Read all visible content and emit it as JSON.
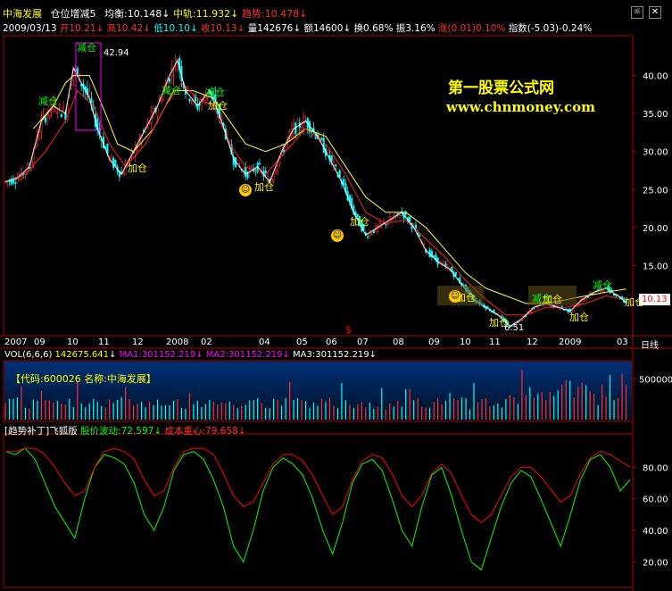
{
  "header": {
    "name": "中海发展",
    "indicator": "仓位增减5",
    "avg_label": "均衡:",
    "avg_value": "10.148",
    "mid_label": "中轨:",
    "mid_value": "11.932",
    "trend_label": "趋势:",
    "trend_value": "10.478",
    "date": "2009/03/13",
    "open": "开10.21",
    "high": "高10.42",
    "low": "低10.10",
    "close": "收10.13",
    "volume": "量142676",
    "amount": "额14600",
    "turnover": "换0.68%",
    "amplitude": "振3.16%",
    "change": "涨(0.01)0.10%",
    "index": "指数(-5.03)-0.24%",
    "colors": {
      "name": "#ffff00",
      "up": "#ff3030",
      "down": "#00ffff",
      "white": "#ffffff"
    }
  },
  "watermark": {
    "title": "第一股票公式网",
    "url": "www.chnmoney.com",
    "color": "#ffff00"
  },
  "annotations": [
    {
      "text": "减仓",
      "color": "#00ff00"
    },
    {
      "text": "减仓",
      "color": "#00ff00"
    },
    {
      "text": "减仓",
      "color": "#00ff00"
    },
    {
      "text": "减仓",
      "color": "#00ff00"
    },
    {
      "text": "减仓",
      "color": "#00ff00"
    },
    {
      "text": "减仓",
      "color": "#00ff00"
    },
    {
      "text": "加仓",
      "color": "#ffff00"
    },
    {
      "text": "加仓",
      "color": "#ffff00"
    },
    {
      "text": "加仓",
      "color": "#ffff00"
    },
    {
      "text": "加仓",
      "color": "#ffff00"
    },
    {
      "text": "加仓",
      "color": "#ffff00"
    },
    {
      "text": "加仓",
      "color": "#ffff00"
    },
    {
      "text": "加仓",
      "color": "#ffff00"
    },
    {
      "text": "加仓",
      "color": "#ffff00"
    },
    {
      "text": "加仓",
      "color": "#ffff00"
    }
  ],
  "extremes": {
    "high": "42.94",
    "low": "6.51"
  },
  "last_price_tag": "10.13",
  "dollar_mark": "$",
  "smileys": 3,
  "time_axis": {
    "labels": [
      "2007",
      "09",
      "10",
      "11",
      "12",
      "2008",
      "02",
      "04",
      "05",
      "06",
      "07",
      "08",
      "09",
      "10",
      "11",
      "12",
      "2009",
      "03"
    ],
    "period": "日线"
  },
  "vol_header": {
    "title": "VOL(6,6,6)",
    "vol": "142675.641",
    "ma1": "MA1:301152.219",
    "ma2": "MA2:301152.219",
    "ma3": "MA3:301152.219",
    "info": "【代码:600026 名称:中海发展】"
  },
  "ind_header": {
    "title": "[趋势补丁]飞狐版",
    "wave_label": "股价波动:",
    "wave_value": "72.597",
    "cost_label": "成本重心:",
    "cost_value": "79.658"
  },
  "chart_data": [
    {
      "type": "candlestick",
      "title": "中海发展",
      "y_axis_ticks": [
        15.0,
        20.0,
        25.0,
        30.0,
        35.0,
        40.0
      ],
      "ylim": [
        6,
        45
      ],
      "grid": false,
      "close_path": [
        [
          0,
          26
        ],
        [
          6,
          26.5
        ],
        [
          12,
          28
        ],
        [
          18,
          34
        ],
        [
          24,
          36
        ],
        [
          30,
          35
        ],
        [
          34,
          41
        ],
        [
          38,
          39
        ],
        [
          42,
          37
        ],
        [
          46,
          33
        ],
        [
          52,
          29
        ],
        [
          58,
          27
        ],
        [
          64,
          30
        ],
        [
          70,
          33
        ],
        [
          76,
          36
        ],
        [
          82,
          40
        ],
        [
          86,
          42
        ],
        [
          90,
          38
        ],
        [
          96,
          36
        ],
        [
          102,
          38
        ],
        [
          108,
          34
        ],
        [
          114,
          29
        ],
        [
          120,
          27
        ],
        [
          126,
          28
        ],
        [
          132,
          26
        ],
        [
          138,
          30
        ],
        [
          144,
          33
        ],
        [
          150,
          34
        ],
        [
          156,
          32
        ],
        [
          162,
          29
        ],
        [
          168,
          26
        ],
        [
          174,
          22
        ],
        [
          180,
          19
        ],
        [
          186,
          20
        ],
        [
          192,
          21
        ],
        [
          198,
          22
        ],
        [
          204,
          20
        ],
        [
          210,
          17
        ],
        [
          216,
          15.5
        ],
        [
          222,
          14.5
        ],
        [
          228,
          12.5
        ],
        [
          234,
          10.5
        ],
        [
          240,
          9.5
        ],
        [
          246,
          8.5
        ],
        [
          252,
          7
        ],
        [
          258,
          8
        ],
        [
          264,
          9.5
        ],
        [
          270,
          10
        ],
        [
          276,
          9.5
        ],
        [
          282,
          9
        ],
        [
          288,
          10.5
        ],
        [
          294,
          11.5
        ],
        [
          300,
          12
        ],
        [
          306,
          11
        ],
        [
          310,
          10.13
        ]
      ],
      "red_line": [
        [
          0,
          26
        ],
        [
          10,
          27
        ],
        [
          20,
          30
        ],
        [
          30,
          34
        ],
        [
          36,
          38
        ],
        [
          44,
          36
        ],
        [
          52,
          31
        ],
        [
          60,
          28
        ],
        [
          70,
          31
        ],
        [
          80,
          36
        ],
        [
          88,
          39
        ],
        [
          96,
          37
        ],
        [
          104,
          36
        ],
        [
          112,
          31
        ],
        [
          120,
          28
        ],
        [
          130,
          27
        ],
        [
          140,
          30
        ],
        [
          150,
          33
        ],
        [
          160,
          31
        ],
        [
          170,
          27
        ],
        [
          180,
          22
        ],
        [
          190,
          20.5
        ],
        [
          200,
          21
        ],
        [
          210,
          18.5
        ],
        [
          220,
          16
        ],
        [
          230,
          13
        ],
        [
          240,
          10.5
        ],
        [
          250,
          8.5
        ],
        [
          260,
          8.5
        ],
        [
          270,
          9.5
        ],
        [
          280,
          9.5
        ],
        [
          290,
          10
        ],
        [
          300,
          11
        ],
        [
          310,
          10.5
        ]
      ],
      "yellow_line": [
        [
          14,
          33
        ],
        [
          24,
          36
        ],
        [
          30,
          39
        ],
        [
          34,
          40
        ],
        [
          42,
          40
        ],
        [
          50,
          35
        ],
        [
          56,
          31
        ],
        [
          64,
          30
        ],
        [
          74,
          33
        ],
        [
          84,
          38
        ],
        [
          94,
          38
        ],
        [
          104,
          37
        ],
        [
          112,
          34
        ],
        [
          120,
          31
        ],
        [
          130,
          30
        ],
        [
          140,
          31
        ],
        [
          150,
          33
        ],
        [
          160,
          32
        ],
        [
          170,
          28
        ],
        [
          180,
          24
        ],
        [
          190,
          22
        ],
        [
          200,
          22
        ],
        [
          210,
          20
        ],
        [
          220,
          17
        ],
        [
          230,
          14
        ],
        [
          240,
          12
        ],
        [
          250,
          11
        ],
        [
          260,
          10
        ],
        [
          270,
          10
        ],
        [
          280,
          10.5
        ],
        [
          290,
          11
        ],
        [
          300,
          11.5
        ],
        [
          310,
          11.9
        ]
      ]
    },
    {
      "type": "bar",
      "title": "VOL(6,6,6)",
      "y_axis_ticks": [
        500000
      ],
      "ylim": [
        0,
        700000
      ],
      "grid": false,
      "series_name": "VOL"
    },
    {
      "type": "line",
      "title": "[趋势补丁]飞狐版",
      "y_axis_ticks": [
        20.0,
        40.0,
        60.0,
        80.0
      ],
      "ylim": [
        5,
        100
      ],
      "grid": false,
      "series": [
        {
          "name": "股价波动",
          "color": "#00ff00",
          "values": [
            90,
            88,
            92,
            85,
            70,
            55,
            45,
            35,
            60,
            80,
            88,
            86,
            82,
            70,
            50,
            40,
            55,
            78,
            88,
            90,
            85,
            72,
            55,
            30,
            20,
            40,
            65,
            80,
            86,
            82,
            75,
            60,
            40,
            25,
            45,
            70,
            82,
            85,
            78,
            60,
            40,
            30,
            55,
            75,
            80,
            62,
            40,
            20,
            15,
            35,
            55,
            70,
            78,
            74,
            60,
            45,
            30,
            50,
            72,
            85,
            88,
            80,
            65,
            72
          ]
        },
        {
          "name": "成本重心",
          "color": "#ff0000",
          "values": [
            90,
            90,
            92,
            92,
            88,
            80,
            70,
            62,
            65,
            80,
            90,
            92,
            90,
            85,
            72,
            62,
            65,
            80,
            90,
            92,
            92,
            88,
            76,
            62,
            55,
            58,
            70,
            82,
            88,
            88,
            84,
            75,
            62,
            50,
            55,
            72,
            84,
            88,
            86,
            76,
            62,
            55,
            62,
            76,
            82,
            76,
            62,
            50,
            45,
            50,
            62,
            74,
            80,
            80,
            74,
            66,
            58,
            62,
            76,
            86,
            90,
            88,
            84,
            80
          ]
        }
      ]
    }
  ]
}
